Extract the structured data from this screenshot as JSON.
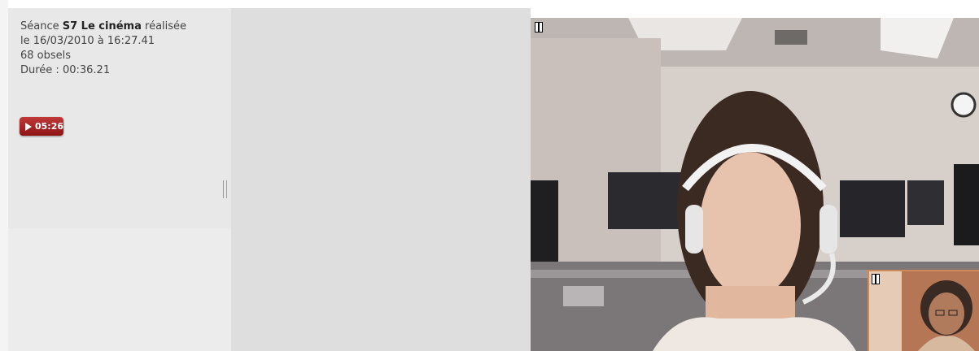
{
  "session": {
    "prefix": "Séance",
    "title": "S7 Le cinéma",
    "suffix": "réalisée",
    "date_line": "le 16/03/2010 à 16:27.41",
    "obsels": "68 obsels",
    "duration": "Durée : 00:36.21"
  },
  "player": {
    "play_time": "05:26",
    "play_icon": "play-icon",
    "pause_icon": "pause-icon"
  }
}
